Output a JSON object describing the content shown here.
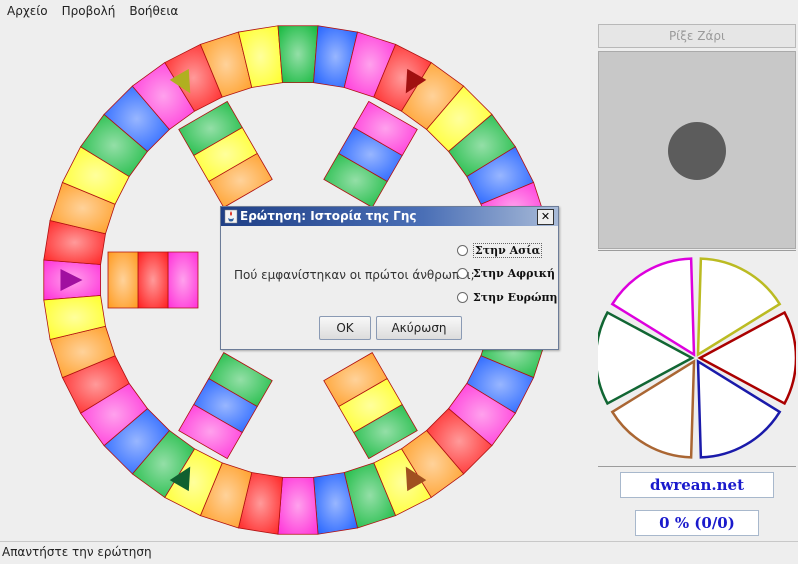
{
  "menu": [
    "Αρχείο",
    "Προβολή",
    "Βοήθεια"
  ],
  "side": {
    "roll_label": "Ρίξε Ζάρι",
    "site_label": "dwrean.net",
    "score_label": "0 % (0/0)"
  },
  "status": "Απαντήστε την ερώτηση",
  "dialog": {
    "title": "Ερώτηση: Ιστορία της Γης",
    "question": "Πού εμφανίστηκαν οι πρώτοι άνθρωποι;",
    "options": [
      "Στην Ασία",
      "Στην Αφρική",
      "Στην Ευρώπη"
    ],
    "ok_label": "OK",
    "cancel_label": "Ακύρωση"
  },
  "categories": [
    {
      "color": "#dd00dd"
    },
    {
      "color": "#bbbb22"
    },
    {
      "color": "#aa0000"
    },
    {
      "color": "#1a1aaa"
    },
    {
      "color": "#aa6633"
    },
    {
      "color": "#116633"
    }
  ],
  "palette": [
    "#ff2fd8",
    "#ff1e1e",
    "#ff9a1e",
    "#ffff22",
    "#12b83c",
    "#1a5cff"
  ]
}
